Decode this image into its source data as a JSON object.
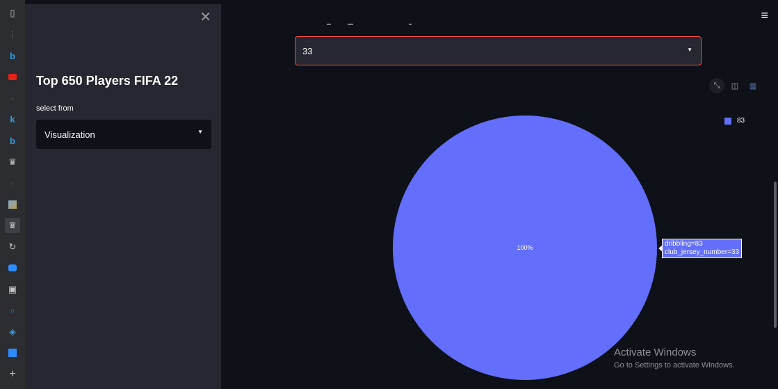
{
  "browser_sidebar": {
    "icons": [
      "sidebar-toggle-icon",
      "grid-icon",
      "bing-icon",
      "youtube-icon",
      "dot-icon",
      "k-icon",
      "bing-icon",
      "crown-icon",
      "dot-icon",
      "image-icon",
      "crown-icon",
      "refresh-icon",
      "zoom-icon",
      "calendar-icon",
      "search-icon",
      "cube-icon",
      "photo-icon",
      "plus-icon"
    ]
  },
  "sidebar": {
    "close_glyph": "✕",
    "title": "Top 650 Players FIFA 22",
    "select_label": "select from",
    "select_value": "Visualization"
  },
  "main": {
    "menu_glyph": "≡",
    "select_value": "33",
    "modebar": [
      "expand-icon",
      "camera-icon",
      "bar-chart-icon"
    ]
  },
  "chart_data": {
    "type": "pie",
    "categories": [
      "83"
    ],
    "values": [
      100
    ],
    "slice_labels": [
      "100%"
    ],
    "colors": [
      "#636efa"
    ],
    "legend": [
      "83"
    ],
    "legend_position": "top-right",
    "tooltip": [
      "dribbling=83",
      "club_jersey_number=33"
    ]
  },
  "watermark": {
    "line1": "Activate Windows",
    "line2": "Go to Settings to activate Windows."
  }
}
